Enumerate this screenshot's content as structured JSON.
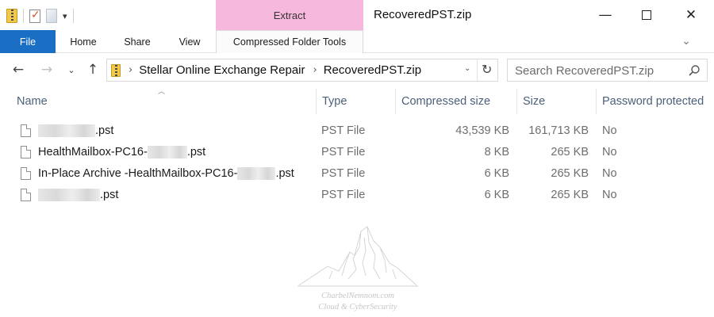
{
  "titlebar": {
    "context_tab_label": "Extract",
    "window_title": "RecoveredPST.zip",
    "qat_dropdown": "▾",
    "controls": {
      "minimize": "—",
      "close": "✕"
    }
  },
  "ribbon": {
    "tabs": [
      {
        "label": "File"
      },
      {
        "label": "Home"
      },
      {
        "label": "Share"
      },
      {
        "label": "View"
      },
      {
        "label": "Compressed Folder Tools"
      }
    ],
    "expand_glyph": "⌄"
  },
  "nav": {
    "back": "←",
    "forward": "→",
    "recent": "⌄",
    "up": "↑",
    "breadcrumb": [
      "Stellar Online Exchange Repair",
      "RecoveredPST.zip"
    ],
    "breadcrumb_separator": "›",
    "address_dropdown": "⌄",
    "refresh": "↻"
  },
  "search": {
    "placeholder": "Search RecoveredPST.zip"
  },
  "columns": {
    "name": "Name",
    "type": "Type",
    "compressed_size": "Compressed size",
    "size": "Size",
    "password_protected": "Password protected"
  },
  "files": [
    {
      "name_prefix": "",
      "name_suffix": ".pst",
      "type": "PST File",
      "compressed_size": "43,539 KB",
      "size": "161,713 KB",
      "password_protected": "No"
    },
    {
      "name_prefix": "HealthMailbox-PC16-",
      "name_suffix": ".pst",
      "type": "PST File",
      "compressed_size": "8 KB",
      "size": "265 KB",
      "password_protected": "No"
    },
    {
      "name_prefix": "In-Place Archive -HealthMailbox-PC16-",
      "name_suffix": ".pst",
      "type": "PST File",
      "compressed_size": "6 KB",
      "size": "265 KB",
      "password_protected": "No"
    },
    {
      "name_prefix": "",
      "name_suffix": ".pst",
      "type": "PST File",
      "compressed_size": "6 KB",
      "size": "265 KB",
      "password_protected": "No"
    }
  ],
  "watermark": {
    "line1": "CharbelNemnom.com",
    "line2": "Cloud & CyberSecurity"
  },
  "colors": {
    "file_tab": "#1a6fc4",
    "context_tab": "#f7b8dd",
    "column_header_text": "#4c607a"
  },
  "icons": {
    "zip_folder": "zip-folder-icon",
    "properties": "properties-icon",
    "new_folder": "new-folder-icon",
    "search": "search-icon",
    "file": "file-icon"
  }
}
